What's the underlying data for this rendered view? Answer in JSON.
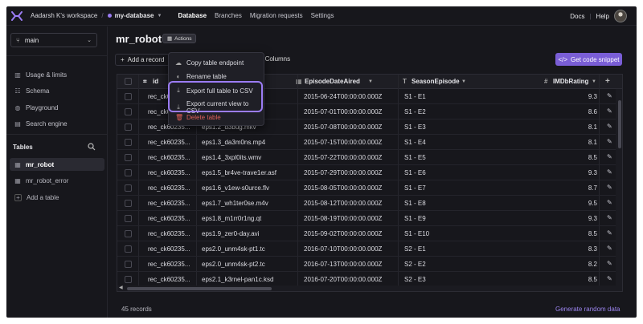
{
  "nav": {
    "workspace": "Aadarsh K's workspace",
    "database": "my-database",
    "links": [
      "Database",
      "Branches",
      "Migration requests",
      "Settings"
    ],
    "docs": "Docs",
    "help": "Help"
  },
  "sidebar": {
    "branch": "main",
    "items": [
      "Usage & limits",
      "Schema",
      "Playground",
      "Search engine"
    ],
    "tables_heading": "Tables",
    "tables": [
      "mr_robot",
      "mr_robot_error"
    ],
    "add_table": "Add a table"
  },
  "main": {
    "title": "mr_robot",
    "actions_label": "Actions",
    "add_record": "Add a record",
    "columns_label": "Columns",
    "snippet_label": "Get code snippet",
    "records_count": "45 records",
    "generate_label": "Generate random data"
  },
  "menu": {
    "items": [
      "Copy table endpoint",
      "Rename table",
      "Export full table to CSV",
      "Export current view to CSV",
      "Delete table"
    ]
  },
  "table": {
    "headers": [
      "id",
      "",
      "EpisodeDateAired",
      "SeasonEpisode",
      "IMDbRating"
    ],
    "rows": [
      {
        "id": "rec_ck6",
        "file": "",
        "date": "2015-06-24T00:00:00.000Z",
        "ep": "S1 - E1",
        "rating": "9.3"
      },
      {
        "id": "rec_ck6",
        "file": "s.mpeg",
        "date": "2015-07-01T00:00:00.000Z",
        "ep": "S1 - E2",
        "rating": "8.6"
      },
      {
        "id": "rec_ck60235...",
        "file": "eps1.2_d3bug.mkv",
        "date": "2015-07-08T00:00:00.000Z",
        "ep": "S1 - E3",
        "rating": "8.1"
      },
      {
        "id": "rec_ck60235...",
        "file": "eps1.3_da3m0ns.mp4",
        "date": "2015-07-15T00:00:00.000Z",
        "ep": "S1 - E4",
        "rating": "8.1"
      },
      {
        "id": "rec_ck60235...",
        "file": "eps1.4_3xpl0its.wmv",
        "date": "2015-07-22T00:00:00.000Z",
        "ep": "S1 - E5",
        "rating": "8.5"
      },
      {
        "id": "rec_ck60235...",
        "file": "eps1.5_br4ve-trave1er.asf",
        "date": "2015-07-29T00:00:00.000Z",
        "ep": "S1 - E6",
        "rating": "9.3"
      },
      {
        "id": "rec_ck60235...",
        "file": "eps1.6_v1ew-s0urce.flv",
        "date": "2015-08-05T00:00:00.000Z",
        "ep": "S1 - E7",
        "rating": "8.7"
      },
      {
        "id": "rec_ck60235...",
        "file": "eps1.7_wh1ter0se.m4v",
        "date": "2015-08-12T00:00:00.000Z",
        "ep": "S1 - E8",
        "rating": "9.5"
      },
      {
        "id": "rec_ck60235...",
        "file": "eps1.8_m1rr0r1ng.qt",
        "date": "2015-08-19T00:00:00.000Z",
        "ep": "S1 - E9",
        "rating": "9.3"
      },
      {
        "id": "rec_ck60235...",
        "file": "eps1.9_zer0-day.avi",
        "date": "2015-09-02T00:00:00.000Z",
        "ep": "S1 - E10",
        "rating": "8.5"
      },
      {
        "id": "rec_ck60235...",
        "file": "eps2.0_unm4sk-pt1.tc",
        "date": "2016-07-10T00:00:00.000Z",
        "ep": "S2 - E1",
        "rating": "8.3"
      },
      {
        "id": "rec_ck60235...",
        "file": "eps2.0_unm4sk-pt2.tc",
        "date": "2016-07-13T00:00:00.000Z",
        "ep": "S2 - E2",
        "rating": "8.2"
      },
      {
        "id": "rec_ck60235...",
        "file": "eps2.1_k3rnel-pan1c.ksd",
        "date": "2016-07-20T00:00:00.000Z",
        "ep": "S2 - E3",
        "rating": "8.5"
      }
    ]
  }
}
